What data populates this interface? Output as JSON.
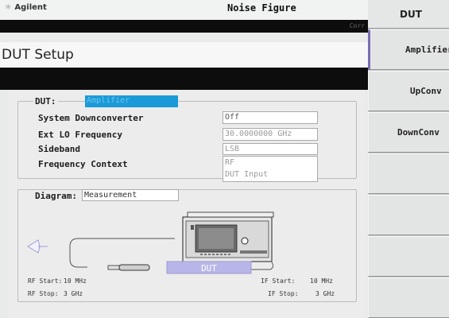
{
  "header": {
    "logo": "Agilent",
    "title": "Noise Figure",
    "corr_label": "Corr"
  },
  "screen_title": "DUT Setup",
  "dut_group": {
    "label": "DUT:",
    "selected_value": "Amplifier",
    "rows": [
      {
        "label": "System Downconverter",
        "value": "Off"
      },
      {
        "label": "Ext LO Frequency",
        "value": "30.0000000 GHz"
      },
      {
        "label": "Sideband",
        "value": "LSB"
      },
      {
        "label": "Frequency Context",
        "value_line1": "RF",
        "value_line2": "DUT Input"
      }
    ]
  },
  "diagram": {
    "label": "Diagram:",
    "value": "Measurement",
    "dut_text": "DUT",
    "rf_start_label": "RF Start:",
    "rf_start_value": "10 MHz",
    "rf_stop_label": "RF Stop:",
    "rf_stop_value": "3 GHz",
    "if_start_label": "IF Start:",
    "if_start_value": "10 MHz",
    "if_stop_label": "IF Stop:",
    "if_stop_value": "3 GHz"
  },
  "softkeys": {
    "menu_title": "DUT",
    "items": [
      {
        "label": "Amplifier"
      },
      {
        "label": "UpConv"
      },
      {
        "label": "DownConv"
      },
      {
        "label": ""
      },
      {
        "label": ""
      },
      {
        "label": ""
      },
      {
        "label": ""
      }
    ]
  },
  "colors": {
    "selection": "#1a9bd8",
    "active_softkey_marker": "#7a6db3",
    "dut_block": "#b8b6e8"
  }
}
